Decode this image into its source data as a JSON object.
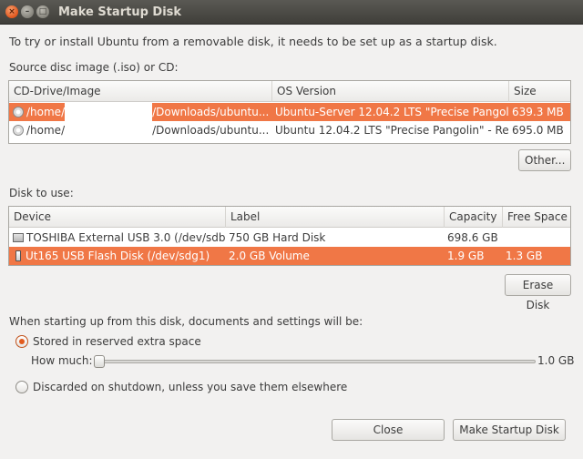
{
  "window": {
    "title": "Make Startup Disk"
  },
  "intro": "To try or install Ubuntu from a removable disk, it needs to be set up as a startup disk.",
  "source": {
    "label": "Source disc image (.iso) or CD:",
    "columns": [
      "CD-Drive/Image",
      "OS Version",
      "Size"
    ],
    "rows": [
      {
        "path_start": "/home/",
        "path_end": "/Downloads/ubuntu...",
        "os": "Ubuntu-Server 12.04.2 LTS \"Precise Pangol...",
        "size": "639.3 MB",
        "selected": true
      },
      {
        "path_start": "/home/",
        "path_end": "/Downloads/ubuntu...",
        "os": "Ubuntu 12.04.2 LTS \"Precise Pangolin\" - Re...",
        "size": "695.0 MB",
        "selected": false
      }
    ],
    "other_button": "Other..."
  },
  "disk": {
    "label": "Disk to use:",
    "columns": [
      "Device",
      "Label",
      "Capacity",
      "Free Space"
    ],
    "rows": [
      {
        "device": "TOSHIBA External USB 3.0 (/dev/sdb)",
        "label": "750 GB Hard Disk",
        "capacity": "698.6 GB",
        "free": "",
        "icon": "hard-disk-icon",
        "selected": false
      },
      {
        "device": "Ut165 USB Flash Disk (/dev/sdg1)",
        "label": "2.0 GB Volume",
        "capacity": "1.9 GB",
        "free": "1.3 GB",
        "icon": "usb-drive-icon",
        "selected": true
      }
    ],
    "erase_button": "Erase Disk"
  },
  "persistence": {
    "heading": "When starting up from this disk, documents and settings will be:",
    "option_stored": "Stored in reserved extra space",
    "how_much_label": "How much:",
    "slider_value": "1.0 GB",
    "option_discarded": "Discarded on shutdown, unless you save them elsewhere",
    "selected_option": "stored"
  },
  "buttons": {
    "close": "Close",
    "make": "Make Startup Disk"
  },
  "colors": {
    "selection": "#f07746",
    "titlebar": "#3f3e3a",
    "window_bg": "#f2f1f0"
  }
}
